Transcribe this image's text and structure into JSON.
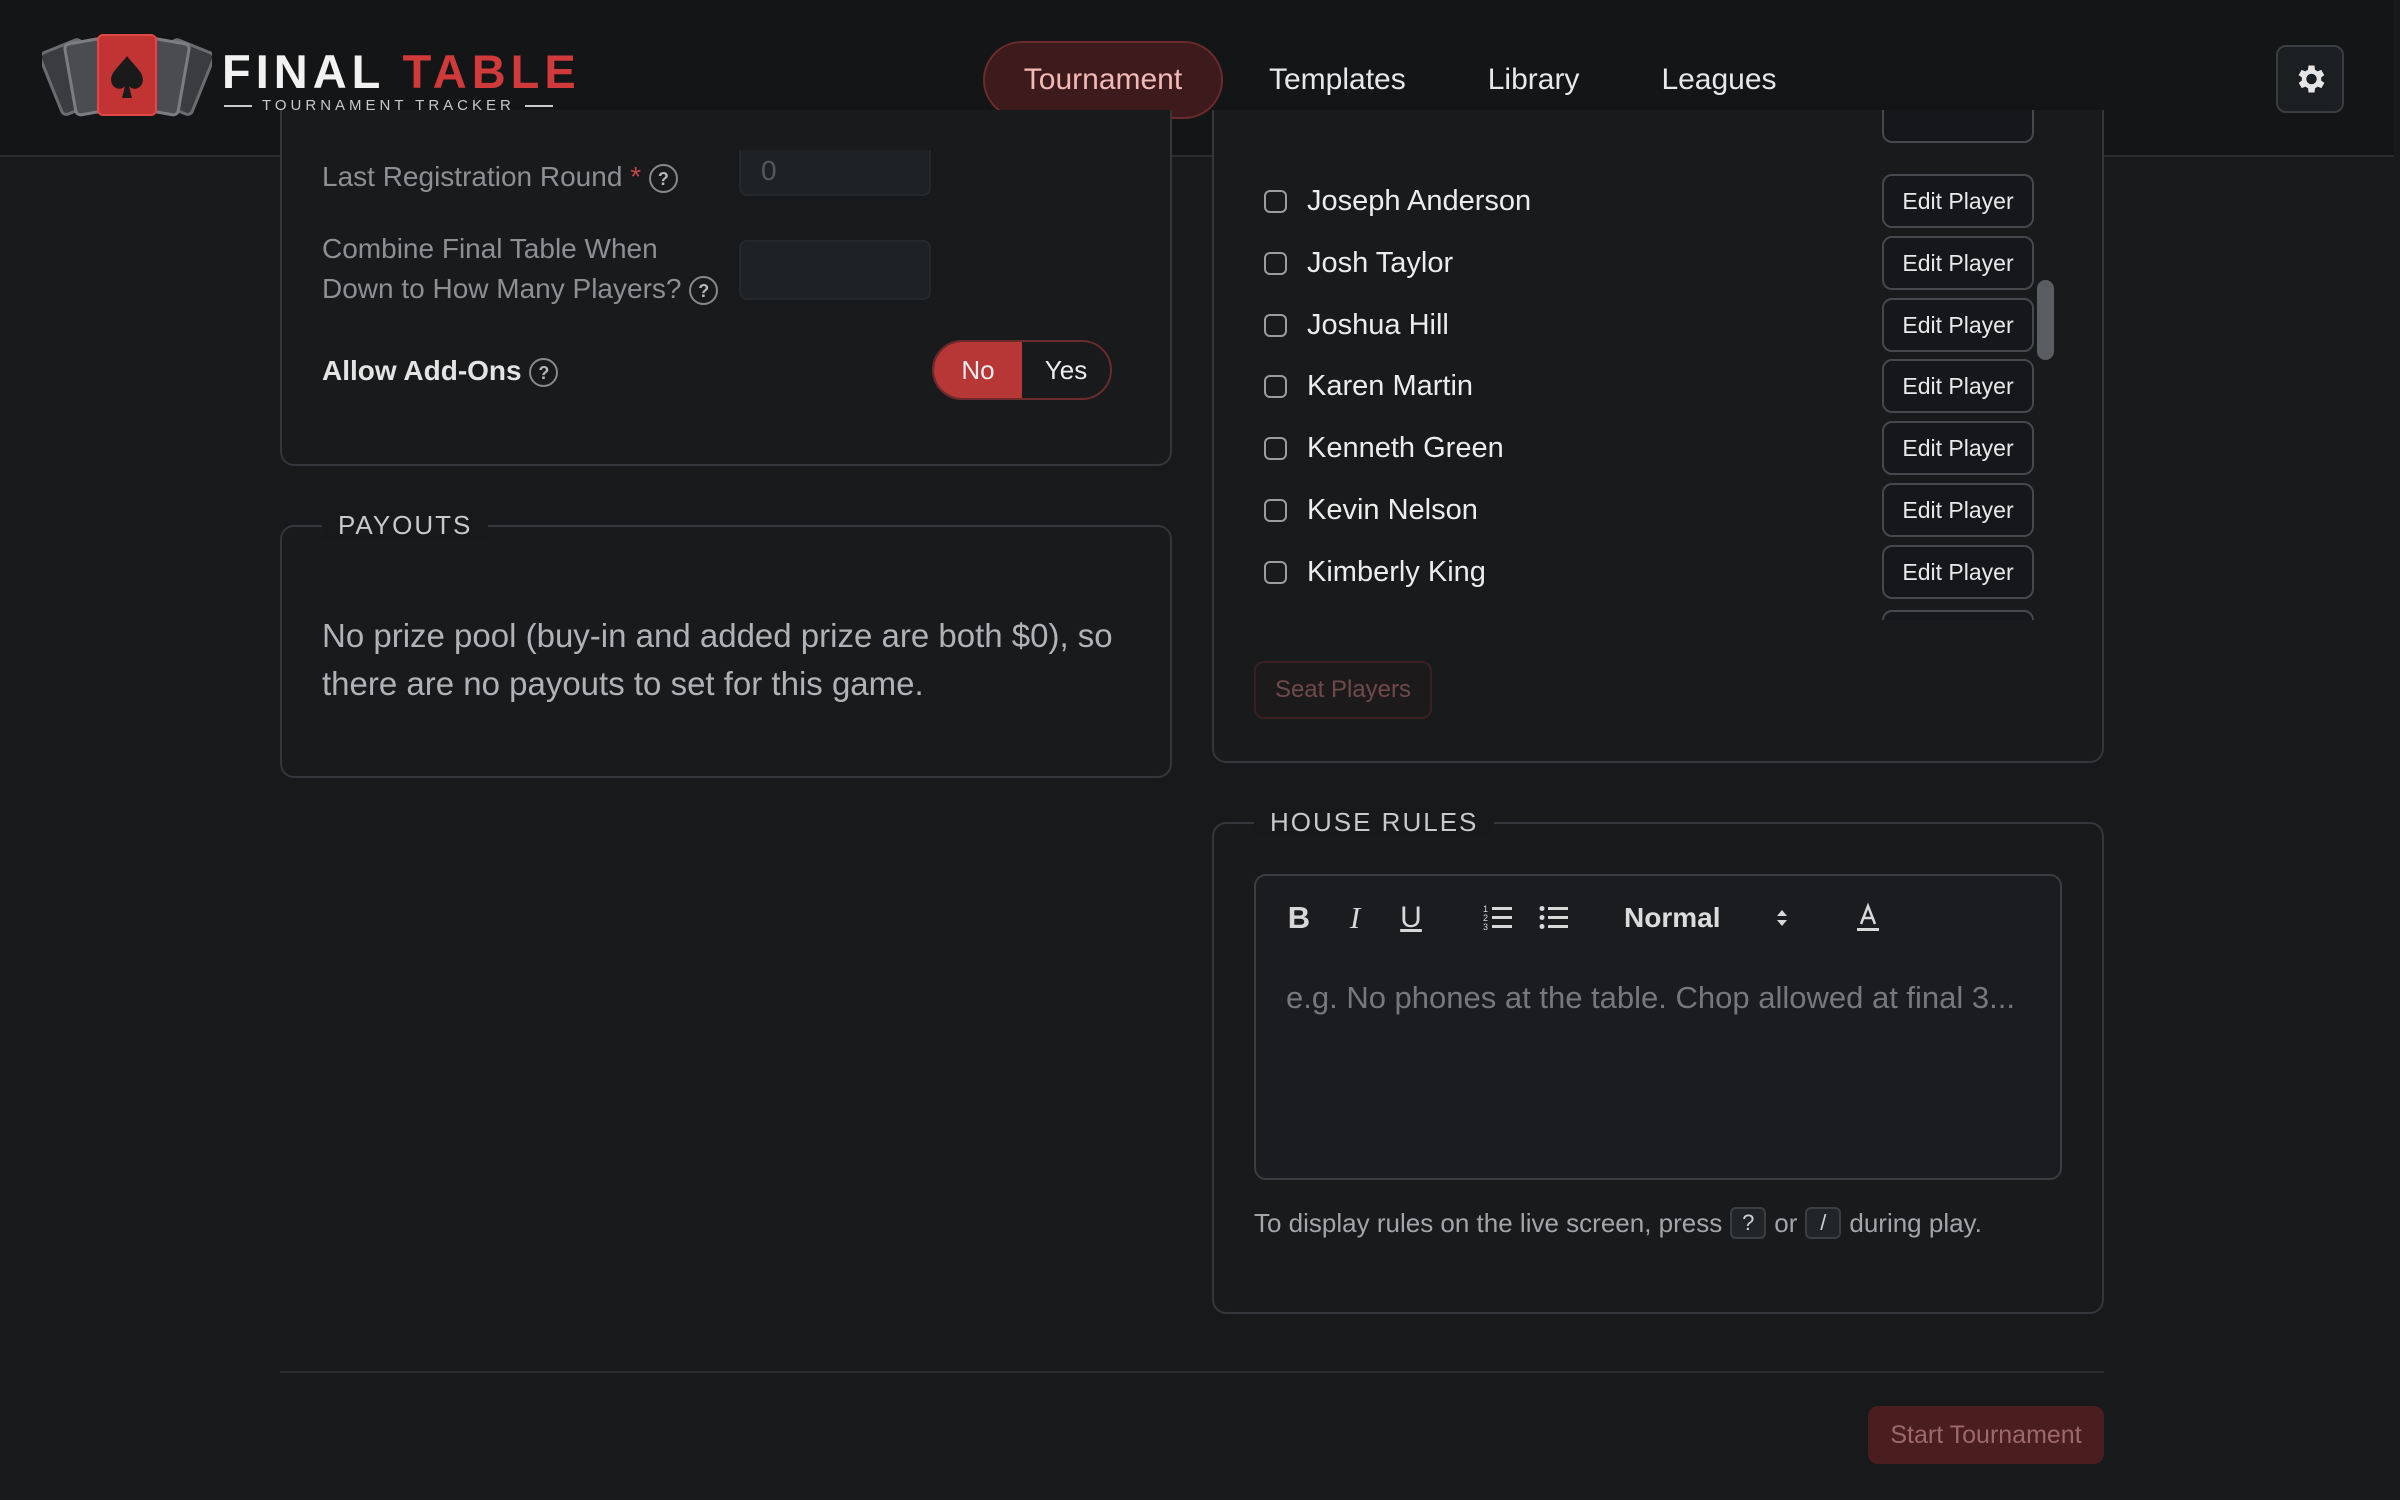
{
  "app": {
    "logo_title_1": "FINAL",
    "logo_title_2": "TABLE",
    "logo_subtitle": "TOURNAMENT TRACKER"
  },
  "nav": {
    "items": [
      {
        "label": "Tournament",
        "active": true
      },
      {
        "label": "Templates",
        "active": false
      },
      {
        "label": "Library",
        "active": false
      },
      {
        "label": "Leagues",
        "active": false
      }
    ],
    "settings_icon": "gear-icon"
  },
  "settings": {
    "last_registration_label": "Last Registration Round",
    "last_registration_required": "*",
    "last_registration_value": "0",
    "combine_label_line1": "Combine Final Table When",
    "combine_label_line2": "Down to How Many Players?",
    "combine_value": "",
    "addons_label": "Allow Add-Ons",
    "addons_no": "No",
    "addons_yes": "Yes",
    "addons_selected": "No",
    "help_glyph": "?"
  },
  "payouts": {
    "legend": "PAYOUTS",
    "message": "No prize pool (buy-in and added prize are both $0), so there are no payouts to set for this game."
  },
  "players": {
    "edit_label": "Edit Player",
    "list": [
      {
        "name": "Joseph Anderson",
        "checked": false
      },
      {
        "name": "Josh Taylor",
        "checked": false
      },
      {
        "name": "Joshua Hill",
        "checked": false
      },
      {
        "name": "Karen Martin",
        "checked": false
      },
      {
        "name": "Kenneth Green",
        "checked": false
      },
      {
        "name": "Kevin Nelson",
        "checked": false
      },
      {
        "name": "Kimberly King",
        "checked": false
      }
    ],
    "seat_button": "Seat Players"
  },
  "house_rules": {
    "legend": "HOUSE RULES",
    "toolbar": {
      "bold": "B",
      "italic": "I",
      "underline": "U",
      "size_value": "Normal"
    },
    "placeholder": "e.g. No phones at the table. Chop allowed at final 3...",
    "hint_before": "To display rules on the live screen, press",
    "hint_key1": "?",
    "hint_or": "or",
    "hint_key2": "/",
    "hint_after": "during play."
  },
  "footer": {
    "start_button": "Start Tournament"
  },
  "colors": {
    "accent": "#b73636",
    "background": "#17191b",
    "header": "#131517"
  }
}
